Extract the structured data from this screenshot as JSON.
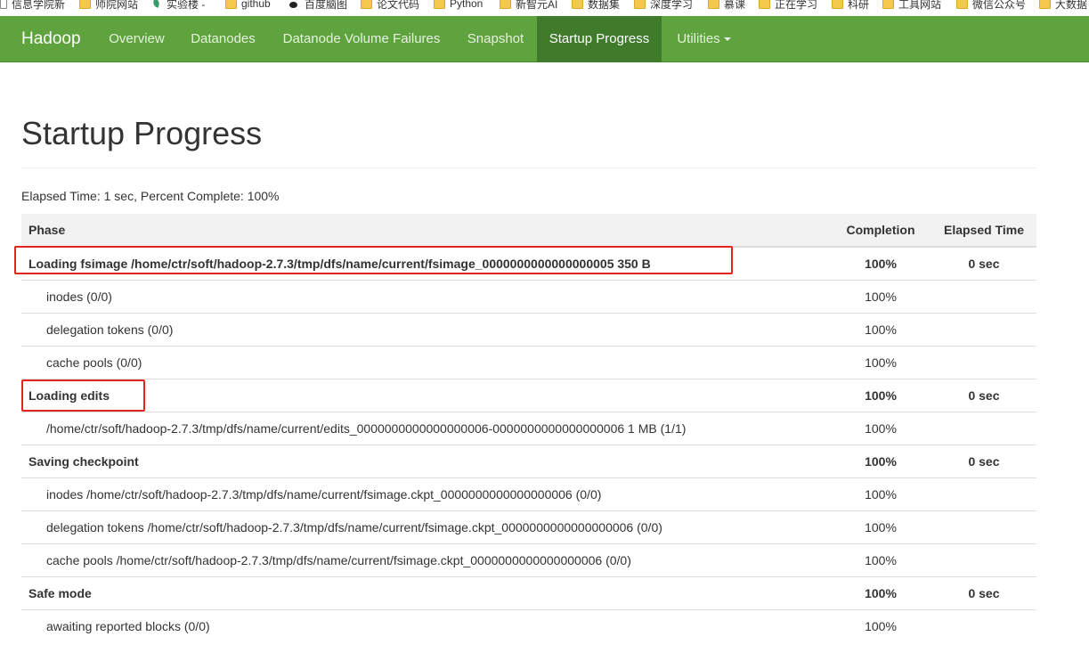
{
  "bookmarks": [
    {
      "label": "信息学院新",
      "icon": "box-icon"
    },
    {
      "label": "师院网站",
      "icon": "folder-icon"
    },
    {
      "label": "实验楼 -",
      "icon": "leaf-icon"
    },
    {
      "label": "github",
      "icon": "folder-icon"
    },
    {
      "label": "百度脑图",
      "icon": "paw-icon"
    },
    {
      "label": "论文代码",
      "icon": "folder-icon"
    },
    {
      "label": "Python",
      "icon": "folder-icon"
    },
    {
      "label": "新智元AI",
      "icon": "folder-icon"
    },
    {
      "label": "数据集",
      "icon": "folder-icon"
    },
    {
      "label": "深度学习",
      "icon": "folder-icon"
    },
    {
      "label": "慕课",
      "icon": "folder-icon"
    },
    {
      "label": "正在学习",
      "icon": "folder-icon"
    },
    {
      "label": "科研",
      "icon": "folder-icon"
    },
    {
      "label": "工具网站",
      "icon": "folder-icon"
    },
    {
      "label": "微信公众号",
      "icon": "folder-icon"
    },
    {
      "label": "大数据",
      "icon": "folder-icon"
    }
  ],
  "navbar": {
    "brand": "Hadoop",
    "items": [
      {
        "label": "Overview",
        "active": false
      },
      {
        "label": "Datanodes",
        "active": false
      },
      {
        "label": "Datanode Volume Failures",
        "active": false
      },
      {
        "label": "Snapshot",
        "active": false
      },
      {
        "label": "Startup Progress",
        "active": true
      },
      {
        "label": "Utilities",
        "active": false,
        "dropdown": true
      }
    ],
    "color": "#5fa33e",
    "active_color": "#3f7b2a"
  },
  "page": {
    "title": "Startup Progress",
    "elapsed_label": "Elapsed Time:",
    "elapsed_value": "1 sec",
    "percent_label": "Percent Complete:",
    "percent_value": "100%"
  },
  "table": {
    "headers": {
      "phase": "Phase",
      "completion": "Completion",
      "elapsed": "Elapsed Time"
    },
    "rows": [
      {
        "type": "phase",
        "name": "Loading fsimage /home/ctr/soft/hadoop-2.7.3/tmp/dfs/name/current/fsimage_0000000000000000005 350 B",
        "completion": "100%",
        "elapsed": "0 sec",
        "highlighted": true
      },
      {
        "type": "step",
        "name": "inodes (0/0)",
        "completion": "100%",
        "elapsed": ""
      },
      {
        "type": "step",
        "name": "delegation tokens (0/0)",
        "completion": "100%",
        "elapsed": ""
      },
      {
        "type": "step",
        "name": "cache pools (0/0)",
        "completion": "100%",
        "elapsed": ""
      },
      {
        "type": "phase",
        "name": "Loading edits",
        "completion": "100%",
        "elapsed": "0 sec",
        "highlighted": true
      },
      {
        "type": "step",
        "name": "/home/ctr/soft/hadoop-2.7.3/tmp/dfs/name/current/edits_0000000000000000006-0000000000000000006 1 MB (1/1)",
        "completion": "100%",
        "elapsed": ""
      },
      {
        "type": "phase",
        "name": "Saving checkpoint",
        "completion": "100%",
        "elapsed": "0 sec"
      },
      {
        "type": "step",
        "name": "inodes /home/ctr/soft/hadoop-2.7.3/tmp/dfs/name/current/fsimage.ckpt_0000000000000000006 (0/0)",
        "completion": "100%",
        "elapsed": ""
      },
      {
        "type": "step",
        "name": "delegation tokens /home/ctr/soft/hadoop-2.7.3/tmp/dfs/name/current/fsimage.ckpt_0000000000000000006 (0/0)",
        "completion": "100%",
        "elapsed": ""
      },
      {
        "type": "step",
        "name": "cache pools /home/ctr/soft/hadoop-2.7.3/tmp/dfs/name/current/fsimage.ckpt_0000000000000000006 (0/0)",
        "completion": "100%",
        "elapsed": ""
      },
      {
        "type": "phase",
        "name": "Safe mode",
        "completion": "100%",
        "elapsed": "0 sec"
      },
      {
        "type": "step",
        "name": "awaiting reported blocks (0/0)",
        "completion": "100%",
        "elapsed": ""
      }
    ]
  },
  "highlight_color": "#e0261e"
}
